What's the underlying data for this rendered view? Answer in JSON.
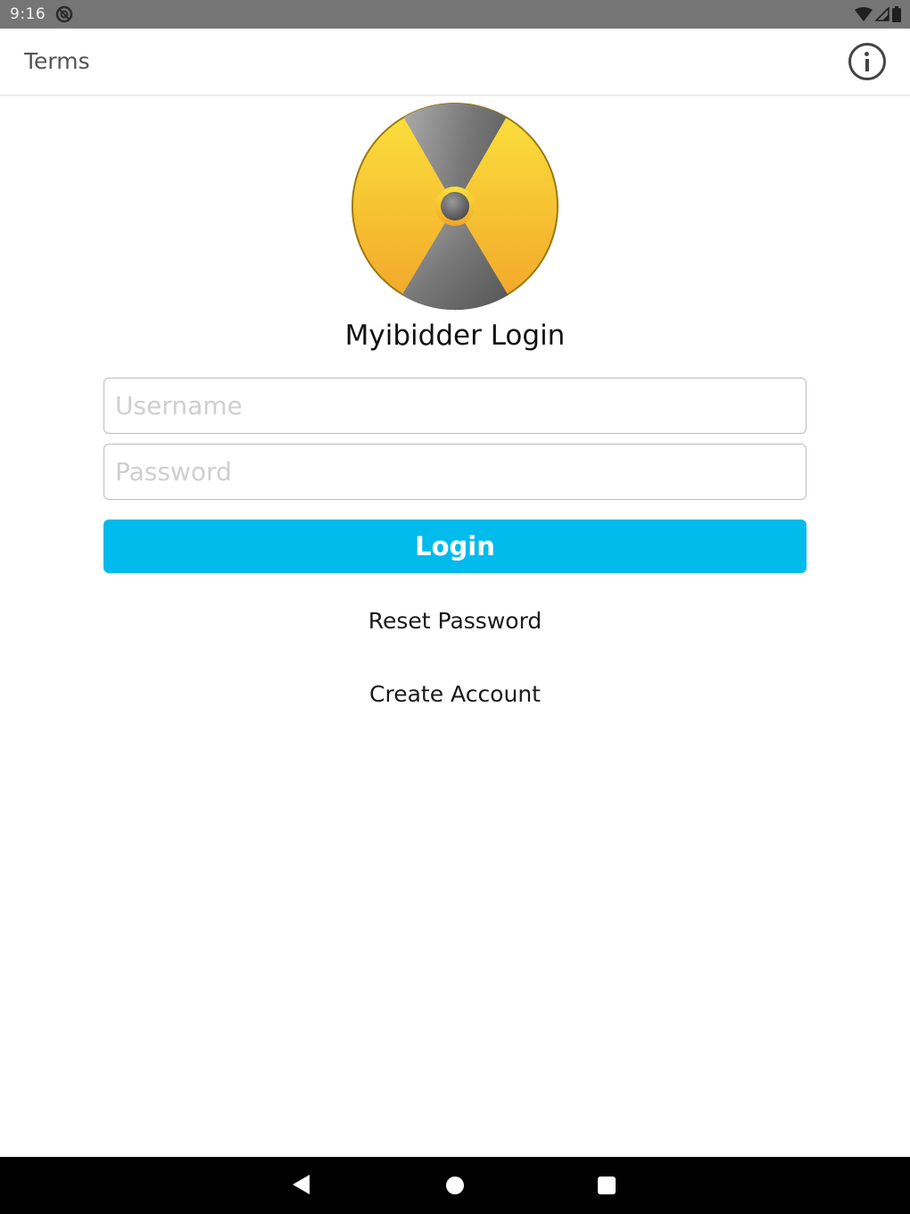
{
  "status_bar": {
    "time": "9:16",
    "icons": [
      "app-notification-icon",
      "wifi-icon",
      "cell-signal-icon",
      "battery-icon"
    ]
  },
  "app_bar": {
    "terms_label": "Terms",
    "info_icon": "info-icon"
  },
  "login": {
    "logo_icon": "radiation-logo-icon",
    "title": "Myibidder Login",
    "username_placeholder": "Username",
    "username_value": "",
    "password_placeholder": "Password",
    "password_value": "",
    "login_label": "Login",
    "reset_password_label": "Reset Password",
    "create_account_label": "Create Account"
  },
  "nav_bar": {
    "icons": [
      "back-icon",
      "home-icon",
      "recents-icon"
    ]
  },
  "colors": {
    "status_bar_bg": "#757575",
    "accent_button": "#00bbec",
    "logo_yellow": "#f5c21a",
    "logo_gray": "#6e6e6e",
    "nav_bar_bg": "#000000"
  }
}
